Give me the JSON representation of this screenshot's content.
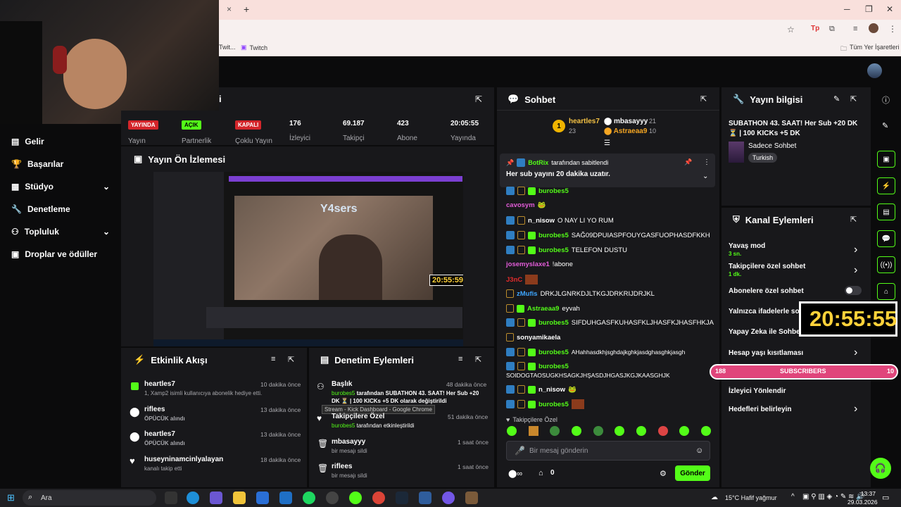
{
  "browser": {
    "tab_close": "×",
    "tab_new": "+",
    "bookmarks": [
      "Twit...",
      "Twitch"
    ],
    "bookmark_folder": "Tüm Yer İşaretleri"
  },
  "sidebar": {
    "items": [
      {
        "label": "Gelir"
      },
      {
        "label": "Başarılar"
      },
      {
        "label": "Stüdyo"
      },
      {
        "label": "Denetleme"
      },
      {
        "label": "Topluluk"
      },
      {
        "label": "Droplar ve ödüller"
      }
    ]
  },
  "stats": {
    "header_fragment": "i",
    "items": [
      {
        "badge": "YAYINDA",
        "label": "Yayın"
      },
      {
        "badge": "AÇIK",
        "label": "Partnerlik"
      },
      {
        "badge": "KAPALI",
        "label": "Çoklu Yayın"
      },
      {
        "value": "176",
        "label": "İzleyici"
      },
      {
        "value": "69.187",
        "label": "Takipçi"
      },
      {
        "value": "423",
        "label": "Abone"
      },
      {
        "value": "20:05:55",
        "label": "Yayında"
      }
    ]
  },
  "preview": {
    "title": "Yayın Ön İzlemesi",
    "timer": "20:55:59",
    "overlay_text": "Y4sers"
  },
  "activity": {
    "title": "Etkinlik Akışı",
    "events": [
      {
        "name": "heartles7",
        "detail": "1, Xamp2 isimli kullanıcıya abonelik hediye etti.",
        "time": "10 dakika önce"
      },
      {
        "name": "riflees",
        "detail": "ÖPÜCÜK alındı",
        "time": "13 dakika önce"
      },
      {
        "name": "heartles7",
        "detail": "ÖPÜCÜK alındı",
        "time": "13 dakika önce"
      },
      {
        "name": "huseyninamcinlyalayan",
        "detail": "kanalı takip etti",
        "time": "18 dakika önce"
      }
    ]
  },
  "moderation": {
    "title": "Denetim Eylemleri",
    "actions": [
      {
        "name": "Başlık",
        "detail_user": "burobes5",
        "detail": "tarafından SUBATHON 43. SAAT! Her Sub +20 DK ⏳ | 100 KICKs +5 DK olarak değiştirildi",
        "time": "48 dakika önce"
      },
      {
        "name": "Takipçilere Özel",
        "detail_user": "burobes5",
        "detail": "tarafından etkinleştirildi",
        "time": "51 dakika önce"
      },
      {
        "name": "mbasayyy",
        "detail": "bir mesajı sildi",
        "time": "1 saat önce"
      },
      {
        "name": "riflees",
        "detail": "bir mesajı sildi",
        "time": "1 saat önce"
      }
    ],
    "tooltip": "Stream - Kick Dashboard - Google Chrome"
  },
  "chat": {
    "title": "Sohbet",
    "leaders": [
      {
        "rank": "1",
        "name": "heartles7",
        "count": "23"
      },
      {
        "name": "mbasayyy",
        "count": "21"
      },
      {
        "name": "Astraeaa9",
        "count": "10"
      }
    ],
    "pinned_by": "BotRix",
    "pinned_suffix": "tarafından sabitlendi",
    "pinned_message": "Her sub yayını 20 dakika uzatır.",
    "messages": [
      {
        "user": "burobes5",
        "text": ""
      },
      {
        "user": "cavosym",
        "text": ""
      },
      {
        "user": "n_nisow",
        "text": "O NAY LI YO RUM"
      },
      {
        "user": "burobes5",
        "text": "SAĞ09DPUIASPFOUYGASFUOPHASDFKKH"
      },
      {
        "user": "burobes5",
        "text": "TELEFON DUSTU"
      },
      {
        "user": "josemyslaxe1",
        "text": "!abone"
      },
      {
        "user": "J3nC",
        "text": ""
      },
      {
        "user": "zMufis",
        "text": "DRKJLGNRKDJLTKGJDRKRIJDRJKL"
      },
      {
        "user": "Astraeaa9",
        "text": "eyvah"
      },
      {
        "user": "burobes5",
        "text": "SIFDUHGASFKUHASFKLJHASFKJHASFHKJA"
      },
      {
        "user": "sonyamikaela",
        "text": ""
      },
      {
        "user": "burobes5",
        "text": "AHahhasdkhjsghdajkghkjasdghasghkjasgh"
      },
      {
        "user": "burobes5",
        "text": "SOIDOGTAOSUGKHSAGKJHŞASDJHGASJKGJKAASGHJK"
      },
      {
        "user": "n_nisow",
        "text": ""
      },
      {
        "user": "burobes5",
        "text": ""
      }
    ],
    "followers_only": "Takipçilere Özel",
    "input_placeholder": "Bir mesaj gönderin",
    "points": "0",
    "send": "Gönder"
  },
  "stream_info": {
    "title": "Yayın bilgisi",
    "stream_title": "SUBATHON 43. SAAT! Her Sub +20 DK ⏳ | 100 KICKs +5 DK",
    "category": "Sadece Sohbet",
    "tag": "Turkish"
  },
  "channel_actions": {
    "title": "Kanal Eylemleri",
    "items": [
      {
        "label": "Yavaş mod",
        "sub": "3 sn."
      },
      {
        "label": "Takipçilere özel sohbet",
        "sub": "1 dk."
      },
      {
        "label": "Abonelere özel sohbet",
        "sub": ""
      },
      {
        "label": "Yalnızca ifadelerle sohbet",
        "sub": ""
      },
      {
        "label": "Yapay Zeka ile Sohbet",
        "sub": ""
      },
      {
        "label": "Hesap yaşı kısıtlaması",
        "sub": ""
      },
      {
        "label": "İzleyici Yönlendir",
        "sub": ""
      },
      {
        "label": "Hedefleri belirleyin",
        "sub": ""
      }
    ]
  },
  "overlay": {
    "timer": "20:55:55",
    "sub_left": "188",
    "sub_label": "SUBSCRIBERS",
    "sub_right": "10"
  },
  "taskbar": {
    "search": "Ara",
    "weather": "15°C  Hafif yağmur",
    "time": "13:37",
    "date": "29.03.2026"
  },
  "colors": {
    "kick_green": "#53fc18",
    "panel": "#18181b",
    "live_red": "#d4252a",
    "sub_pink": "#e0457b"
  }
}
